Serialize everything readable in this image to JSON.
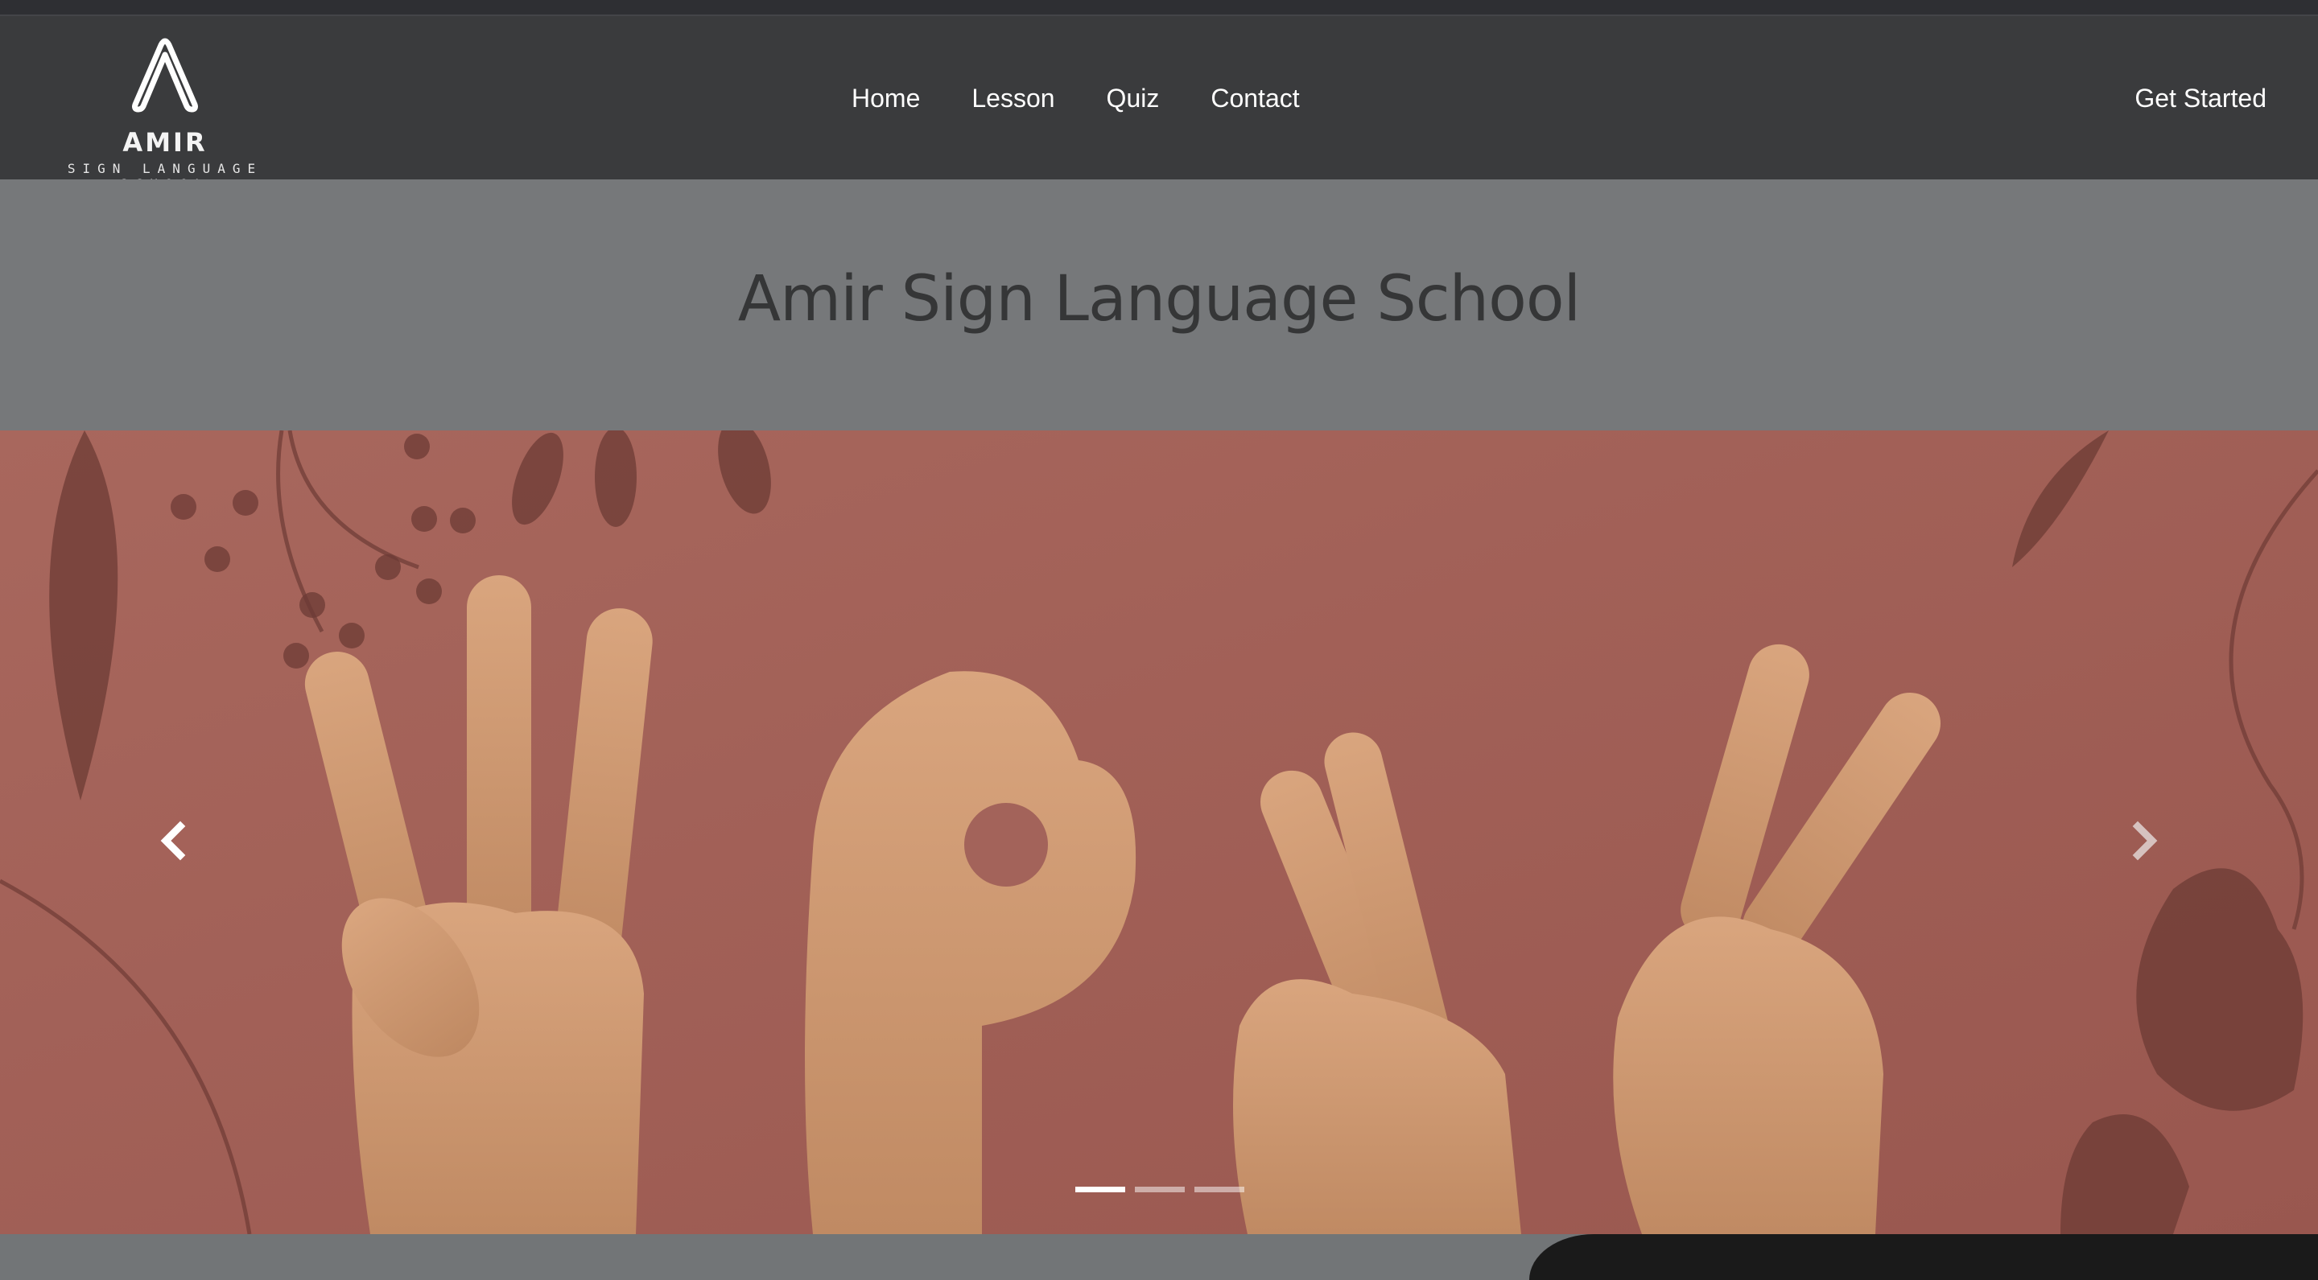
{
  "brand": {
    "name": "AMIR",
    "tagline": "SIGN LANGUAGE SCHOOL",
    "logo_icon": "a-mark-logo"
  },
  "nav": {
    "links": [
      {
        "label": "Home"
      },
      {
        "label": "Lesson"
      },
      {
        "label": "Quiz"
      },
      {
        "label": "Contact"
      }
    ],
    "cta_label": "Get Started"
  },
  "hero": {
    "title": "Amir Sign Language School"
  },
  "carousel": {
    "prev_icon": "chevron-left-icon",
    "next_icon": "chevron-right-icon",
    "slide_count": 3,
    "active_index": 0,
    "image_description_icon": "hands-signing-image"
  },
  "colors": {
    "navbar": "#3a3b3d",
    "hero_band": "#76787a",
    "carousel_bg": "#a3635a",
    "title_text": "#353637"
  }
}
